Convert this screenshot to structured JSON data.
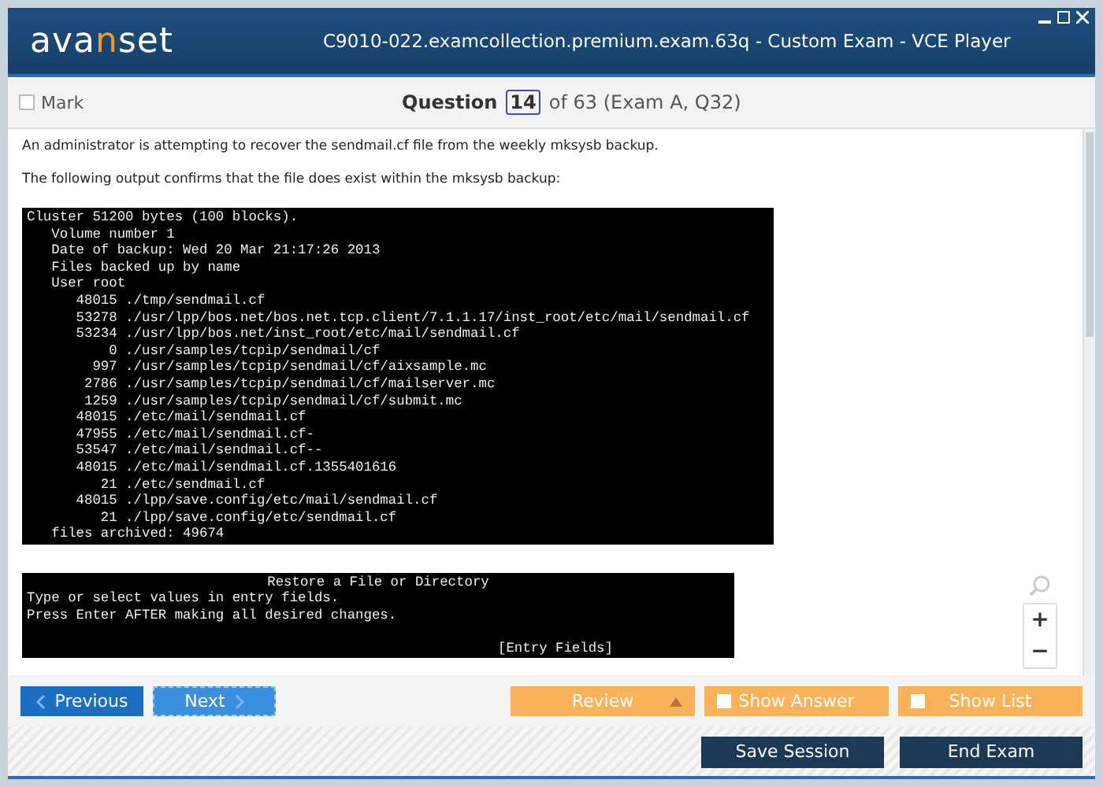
{
  "window": {
    "title": "C9010-022.examcollection.premium.exam.63q - Custom Exam - VCE Player",
    "logo_parts": [
      "ava",
      "n",
      "set"
    ]
  },
  "question_bar": {
    "mark": {
      "label": "Mark",
      "checked": false
    },
    "label": "Question",
    "number": "14",
    "suffix": "of 63 (Exam A, Q32)"
  },
  "question": {
    "paragraphs": [
      "An administrator is attempting to recover the sendmail.cf file from the weekly mksysb backup.",
      "The following output confirms that the file does exist within the mksysb backup:"
    ],
    "exhibits": [
      {
        "lines": [
          "Cluster 51200 bytes (100 blocks).",
          "   Volume number 1",
          "   Date of backup: Wed 20 Mar 21:17:26 2013",
          "   Files backed up by name",
          "   User root",
          "      48015 ./tmp/sendmail.cf",
          "      53278 ./usr/lpp/bos.net/bos.net.tcp.client/7.1.1.17/inst_root/etc/mail/sendmail.cf",
          "      53234 ./usr/lpp/bos.net/inst_root/etc/mail/sendmail.cf",
          "          0 ./usr/samples/tcpip/sendmail/cf",
          "        997 ./usr/samples/tcpip/sendmail/cf/aixsample.mc",
          "       2786 ./usr/samples/tcpip/sendmail/cf/mailserver.mc",
          "       1259 ./usr/samples/tcpip/sendmail/cf/submit.mc",
          "      48015 ./etc/mail/sendmail.cf",
          "      47955 ./etc/mail/sendmail.cf-",
          "      53547 ./etc/mail/sendmail.cf--",
          "      48015 ./etc/mail/sendmail.cf.1355401616",
          "         21 ./etc/sendmail.cf",
          "      48015 ./lpp/save.config/etc/mail/sendmail.cf",
          "         21 ./lpp/save.config/etc/sendmail.cf",
          "   files archived: 49674"
        ]
      },
      {
        "title": "Restore a File or Directory",
        "lines": [
          "Type or select values in entry fields.",
          "Press Enter AFTER making all desired changes."
        ],
        "fields_header": "[Entry Fields]"
      }
    ]
  },
  "zoom": {
    "zoom_in": "+",
    "zoom_out": "−"
  },
  "nav": {
    "previous": "Previous",
    "next": "Next",
    "review": "Review",
    "show_answer": {
      "label": "Show Answer",
      "checked": false
    },
    "show_list": {
      "label": "Show List",
      "checked": false
    }
  },
  "footer": {
    "buttons": [
      "Save Session",
      "End Exam"
    ]
  }
}
